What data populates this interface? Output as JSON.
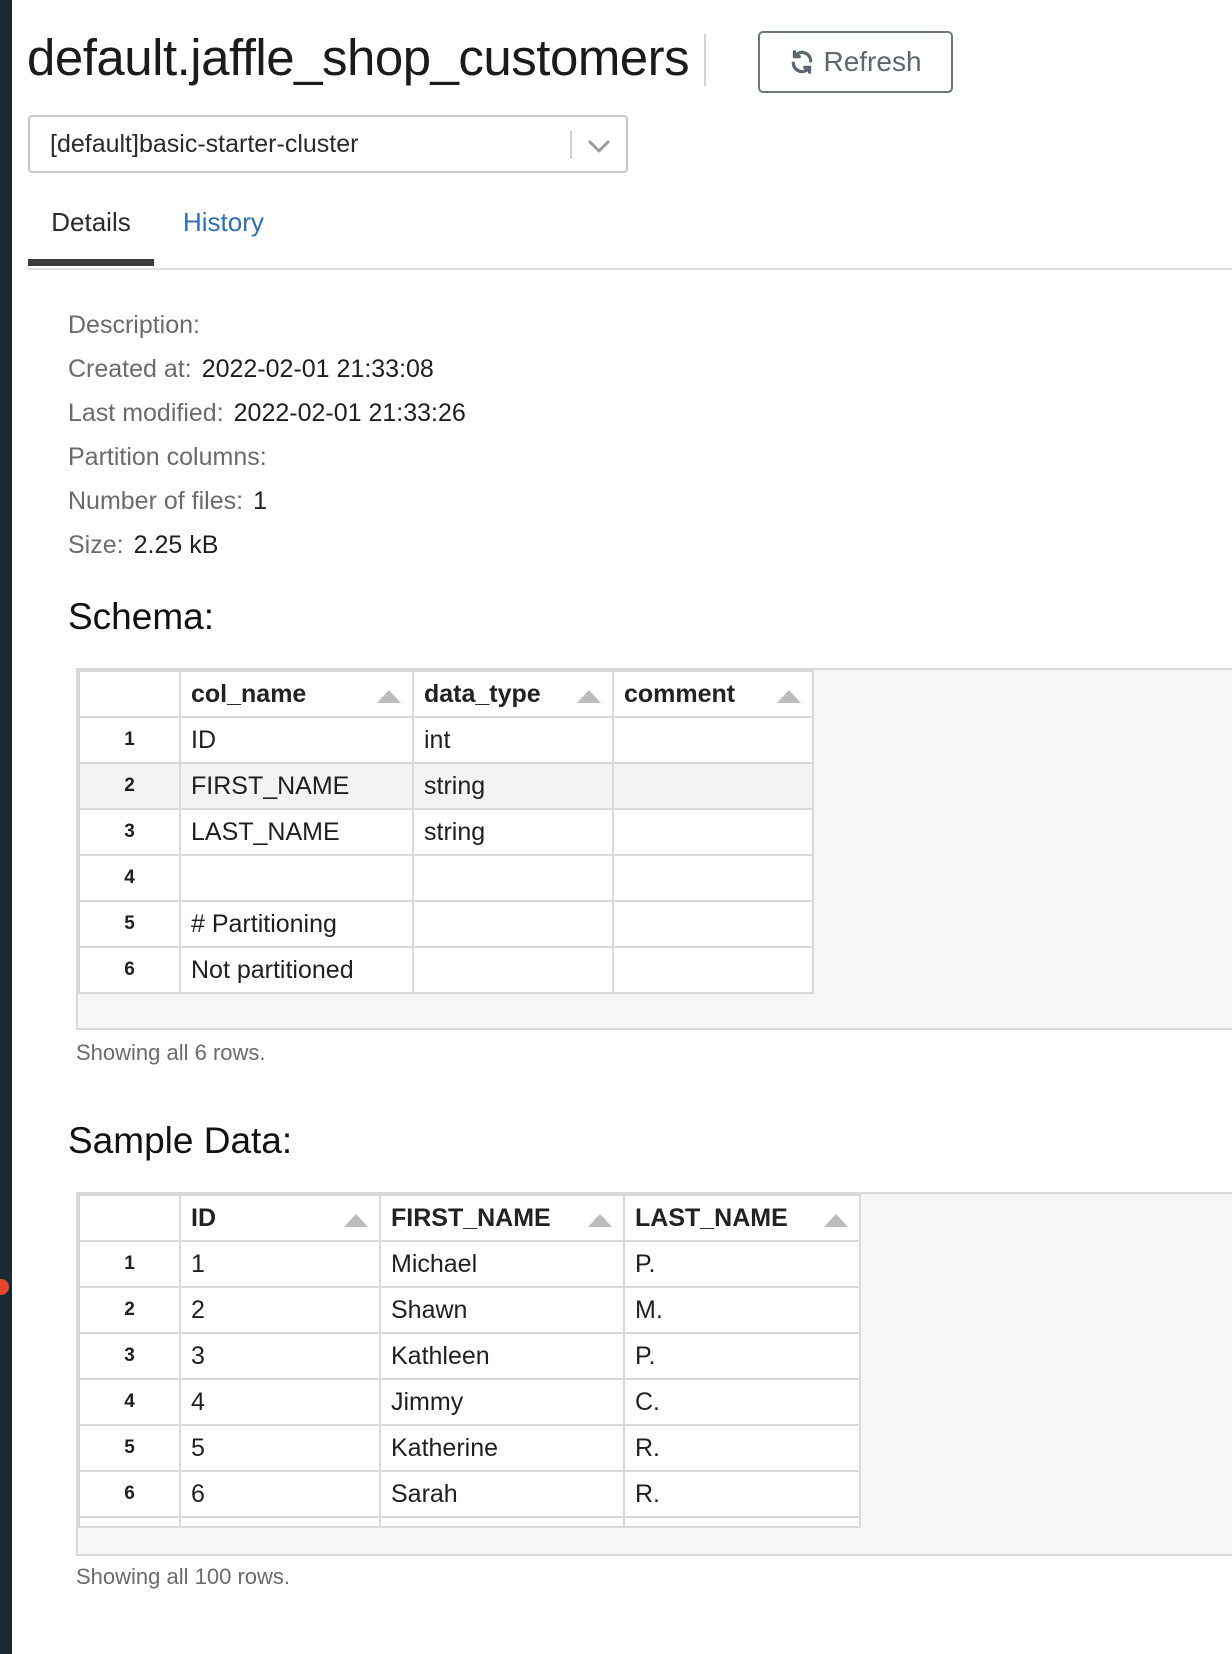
{
  "header": {
    "title": "default.jaffle_shop_customers",
    "refresh_label": "Refresh"
  },
  "cluster_select": {
    "value": "[default]basic-starter-cluster"
  },
  "tabs": [
    {
      "label": "Details",
      "active": true
    },
    {
      "label": "History",
      "active": false
    }
  ],
  "details": {
    "description_label": "Description:",
    "description_value": "",
    "created_label": "Created at:",
    "created_value": "2022-02-01 21:33:08",
    "modified_label": "Last modified:",
    "modified_value": "2022-02-01 21:33:26",
    "partition_label": "Partition columns:",
    "partition_value": "",
    "files_label": "Number of files:",
    "files_value": "1",
    "size_label": "Size:",
    "size_value": "2.25 kB"
  },
  "schema": {
    "title": "Schema:",
    "columns": [
      "col_name",
      "data_type",
      "comment"
    ],
    "rows": [
      {
        "n": "1",
        "col_name": "ID",
        "data_type": "int",
        "comment": ""
      },
      {
        "n": "2",
        "col_name": "FIRST_NAME",
        "data_type": "string",
        "comment": ""
      },
      {
        "n": "3",
        "col_name": "LAST_NAME",
        "data_type": "string",
        "comment": ""
      },
      {
        "n": "4",
        "col_name": "",
        "data_type": "",
        "comment": ""
      },
      {
        "n": "5",
        "col_name": "# Partitioning",
        "data_type": "",
        "comment": ""
      },
      {
        "n": "6",
        "col_name": "Not partitioned",
        "data_type": "",
        "comment": ""
      }
    ],
    "footer": "Showing all 6 rows."
  },
  "sample": {
    "title": "Sample Data:",
    "columns": [
      "ID",
      "FIRST_NAME",
      "LAST_NAME"
    ],
    "rows": [
      {
        "n": "1",
        "id": "1",
        "first": "Michael",
        "last": "P."
      },
      {
        "n": "2",
        "id": "2",
        "first": "Shawn",
        "last": "M."
      },
      {
        "n": "3",
        "id": "3",
        "first": "Kathleen",
        "last": "P."
      },
      {
        "n": "4",
        "id": "4",
        "first": "Jimmy",
        "last": "C."
      },
      {
        "n": "5",
        "id": "5",
        "first": "Katherine",
        "last": "R."
      },
      {
        "n": "6",
        "id": "6",
        "first": "Sarah",
        "last": "R."
      }
    ],
    "footer": "Showing all 100 rows."
  },
  "icons": {
    "refresh": "refresh-icon",
    "dropdown": "chevron-down-icon",
    "sort": "sort-asc-icon"
  },
  "colors": {
    "link": "#2f6fb4",
    "rail": "#1e2a32",
    "alert_dot": "#e8452c"
  }
}
